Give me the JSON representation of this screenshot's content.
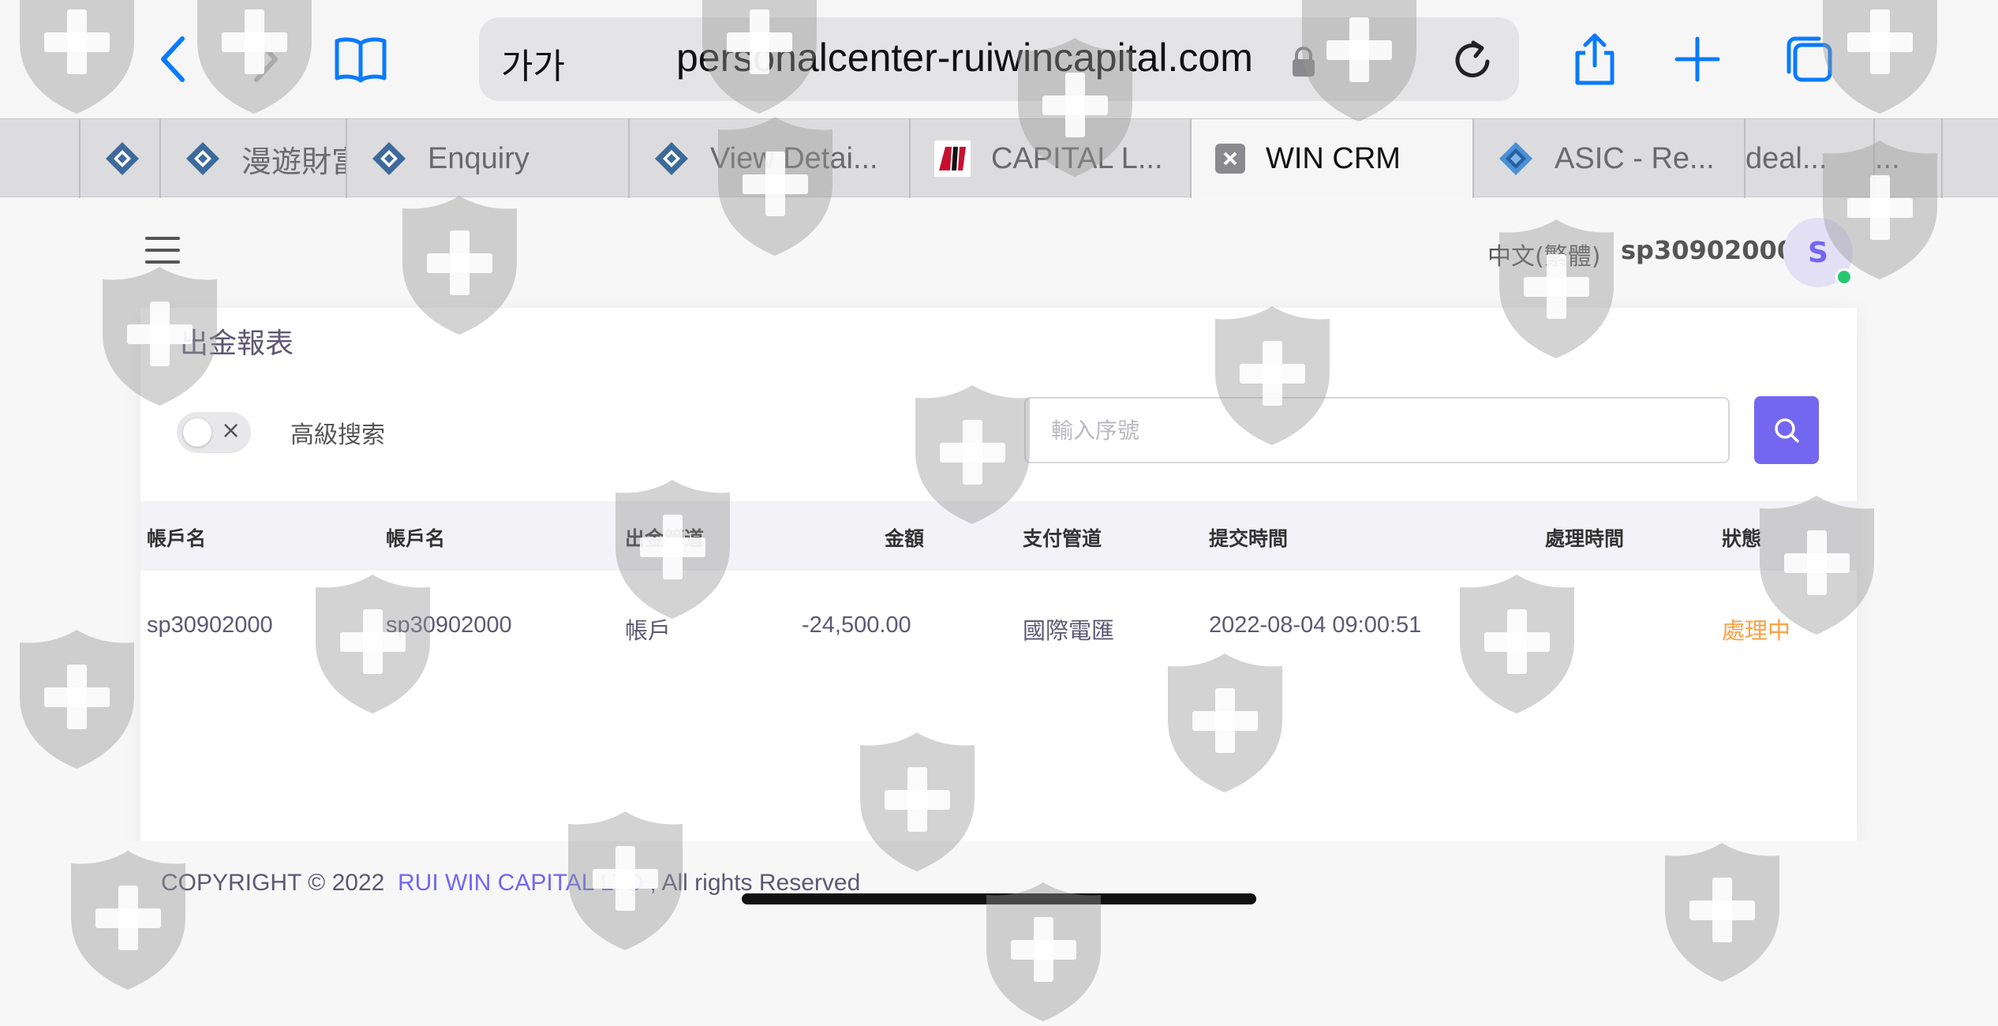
{
  "browser": {
    "text_size_label": "가가",
    "url": "personalcenter-ruiwincapital.com",
    "tabs": [
      {
        "label": "",
        "active": false
      },
      {
        "label": "漫遊財富",
        "active": false
      },
      {
        "label": "Enquiry",
        "active": false
      },
      {
        "label": "View Detai...",
        "active": false
      },
      {
        "label": "CAPITAL L...",
        "active": false
      },
      {
        "label": "WIN CRM",
        "active": true
      },
      {
        "label": "ASIC - Re...",
        "active": false
      },
      {
        "label": "deal...",
        "active": false
      },
      {
        "label": "...",
        "active": false
      }
    ]
  },
  "header": {
    "language": "中文(繁體)",
    "username": "sp30902000",
    "avatar_initial": "S"
  },
  "page": {
    "title": "出金報表",
    "advanced_search_label": "高級搜索",
    "toggle_symbol": "×",
    "search_placeholder": "輸入序號"
  },
  "table": {
    "columns": [
      "帳戶名",
      "帳戶名",
      "出金管道",
      "金額",
      "支付管道",
      "提交時間",
      "處理時間",
      "狀態"
    ],
    "rows": [
      [
        "sp30902000",
        "sp30902000",
        "帳戶",
        "-24,500.00",
        "國際電匯",
        "2022-08-04 09:00:51",
        "",
        "處理中"
      ]
    ]
  },
  "footer": {
    "prefix": "COPYRIGHT © 2022",
    "company": "RUI WIN CAPITAL LTD",
    "suffix": ", All rights Reserved"
  },
  "colors": {
    "accent": "#7367f0",
    "status_pending": "#ff9f43",
    "browser_blue": "#0a7aff",
    "online": "#28c76f"
  },
  "icons": [
    "back-icon",
    "forward-icon",
    "bookmarks-icon",
    "lock-icon",
    "reload-icon",
    "share-icon",
    "new-tab-icon",
    "tabs-overview-icon",
    "menu-icon",
    "search-icon",
    "shield-watermark-icon"
  ]
}
